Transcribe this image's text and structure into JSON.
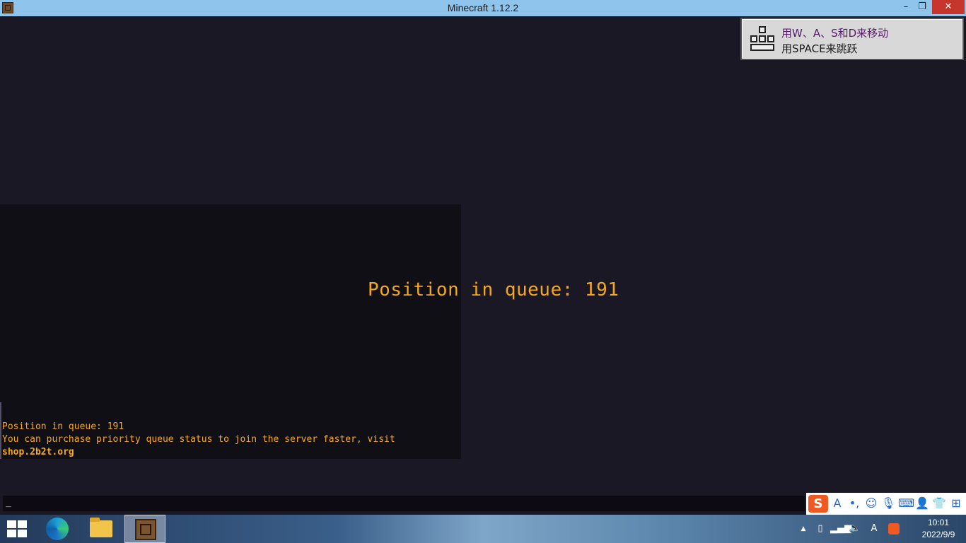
{
  "window": {
    "title": "Minecraft 1.12.2",
    "minimize_glyph": "–",
    "restore_glyph": "❐",
    "close_glyph": "✕"
  },
  "game": {
    "queue_title": "Position in queue: 191",
    "chat": {
      "line1": "Position in queue: 191",
      "line2": "You can purchase priority queue status to join the server faster, visit",
      "line3": "shop.2b2t.org"
    },
    "chat_input_cursor": "_"
  },
  "toast": {
    "line1": "用W、A、S和D来移动",
    "line2": "用SPACE来跳跃",
    "icon": "keyboard-keys-icon"
  },
  "ime": {
    "logo": "S",
    "items": [
      "A",
      "•,",
      "☺",
      "🎙",
      "⌨",
      "👤",
      "👕",
      "⊞"
    ]
  },
  "taskbar": {
    "apps": [
      "windows-start",
      "edge",
      "file-explorer",
      "minecraft"
    ],
    "tray": {
      "chevron": "▲",
      "ime_lang": "A",
      "time": "10:01",
      "date": "2022/9/9"
    }
  },
  "colors": {
    "title_bar": "#8fc4ec",
    "game_bg": "#1b1825",
    "queue_text": "#f2a81a",
    "close_button": "#c7362c"
  }
}
